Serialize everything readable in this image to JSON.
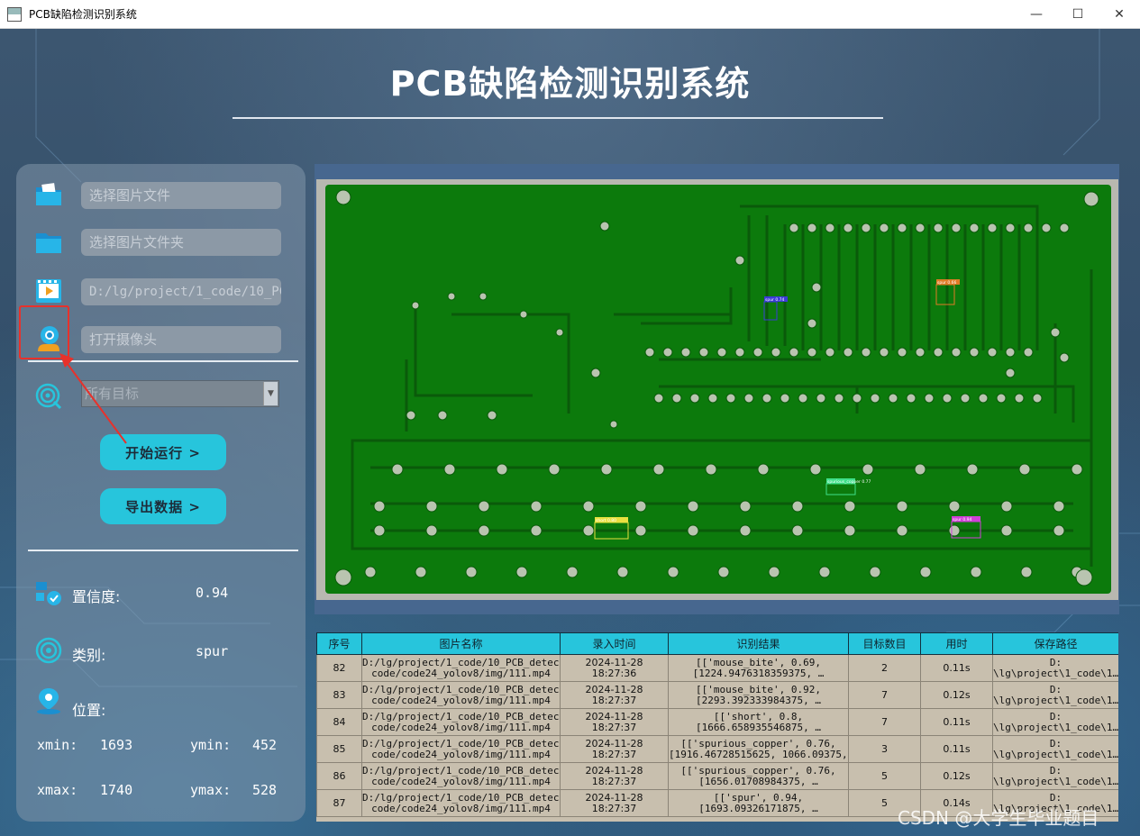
{
  "window": {
    "title": "PCB缺陷检测识别系统",
    "controls": [
      "—",
      "☐",
      "✕"
    ]
  },
  "header": {
    "title": "PCB缺陷检测识别系统"
  },
  "sidebar": {
    "image_file_placeholder": "选择图片文件",
    "image_folder_placeholder": "选择图片文件夹",
    "video_path_value": "D:/lg/project/1_code/10_PCB",
    "camera_placeholder": "打开摄像头",
    "target_select_value": "所有目标",
    "start_button": "开始运行 >",
    "export_button": "导出数据 >"
  },
  "result": {
    "confidence_label": "置信度:",
    "confidence_value": "0.94",
    "class_label": "类别:",
    "class_value": "spur",
    "position_label": "位置:",
    "xmin_label": "xmin:",
    "xmin_value": "1693",
    "ymin_label": "ymin:",
    "ymin_value": "452",
    "xmax_label": "xmax:",
    "xmax_value": "1740",
    "ymax_label": "ymax:",
    "ymax_value": "528"
  },
  "detections": [
    {
      "label": "spur 0.74",
      "color": "#3b3bd6"
    },
    {
      "label": "spur 0.66",
      "color": "#e07b26"
    },
    {
      "label": "spurious_copper 0.77",
      "color": "#3fe08a"
    },
    {
      "label": "spur 0.94",
      "color": "#d040d8"
    },
    {
      "label": "short 0.80",
      "color": "#e8e040"
    }
  ],
  "table": {
    "headers": [
      "序号",
      "图片名称",
      "录入时间",
      "识别结果",
      "目标数目",
      "用时",
      "保存路径"
    ],
    "rows": [
      [
        "82",
        "D:/lg/project/1_code/10_PCB_detect/\ncode/code24_yolov8/img/111.mp4",
        "2024-11-28\n18:27:36",
        "[['mouse_bite', 0.69,\n[1224.9476318359375, …",
        "2",
        "0.11s",
        "D:\n\\lg\\project\\1_code\\1…"
      ],
      [
        "83",
        "D:/lg/project/1_code/10_PCB_detect/\ncode/code24_yolov8/img/111.mp4",
        "2024-11-28\n18:27:37",
        "[['mouse_bite', 0.92,\n[2293.392333984375, …",
        "7",
        "0.12s",
        "D:\n\\lg\\project\\1_code\\1…"
      ],
      [
        "84",
        "D:/lg/project/1_code/10_PCB_detect/\ncode/code24_yolov8/img/111.mp4",
        "2024-11-28\n18:27:37",
        "[['short', 0.8,\n[1666.658935546875, …",
        "7",
        "0.11s",
        "D:\n\\lg\\project\\1_code\\1…"
      ],
      [
        "85",
        "D:/lg/project/1_code/10_PCB_detect/\ncode/code24_yolov8/img/111.mp4",
        "2024-11-28\n18:27:37",
        "[['spurious_copper', 0.76,\n[1916.46728515625, 1066.09375, …",
        "3",
        "0.11s",
        "D:\n\\lg\\project\\1_code\\1…"
      ],
      [
        "86",
        "D:/lg/project/1_code/10_PCB_detect/\ncode/code24_yolov8/img/111.mp4",
        "2024-11-28\n18:27:37",
        "[['spurious_copper', 0.76,\n[1656.01708984375, …",
        "5",
        "0.12s",
        "D:\n\\lg\\project\\1_code\\1…"
      ],
      [
        "87",
        "D:/lg/project/1_code/10_PCB_detect/\ncode/code24_yolov8/img/111.mp4",
        "2024-11-28\n18:27:37",
        "[['spur', 0.94,\n[1693.09326171875, …",
        "5",
        "0.14s",
        "D:\n\\lg\\project\\1_code\\1…"
      ]
    ]
  },
  "watermark": "CSDN @大学生毕业题目",
  "colors": {
    "accent": "#27c5dc",
    "highlight": "#e8312b",
    "pcb_green": "#0c7a0c"
  }
}
